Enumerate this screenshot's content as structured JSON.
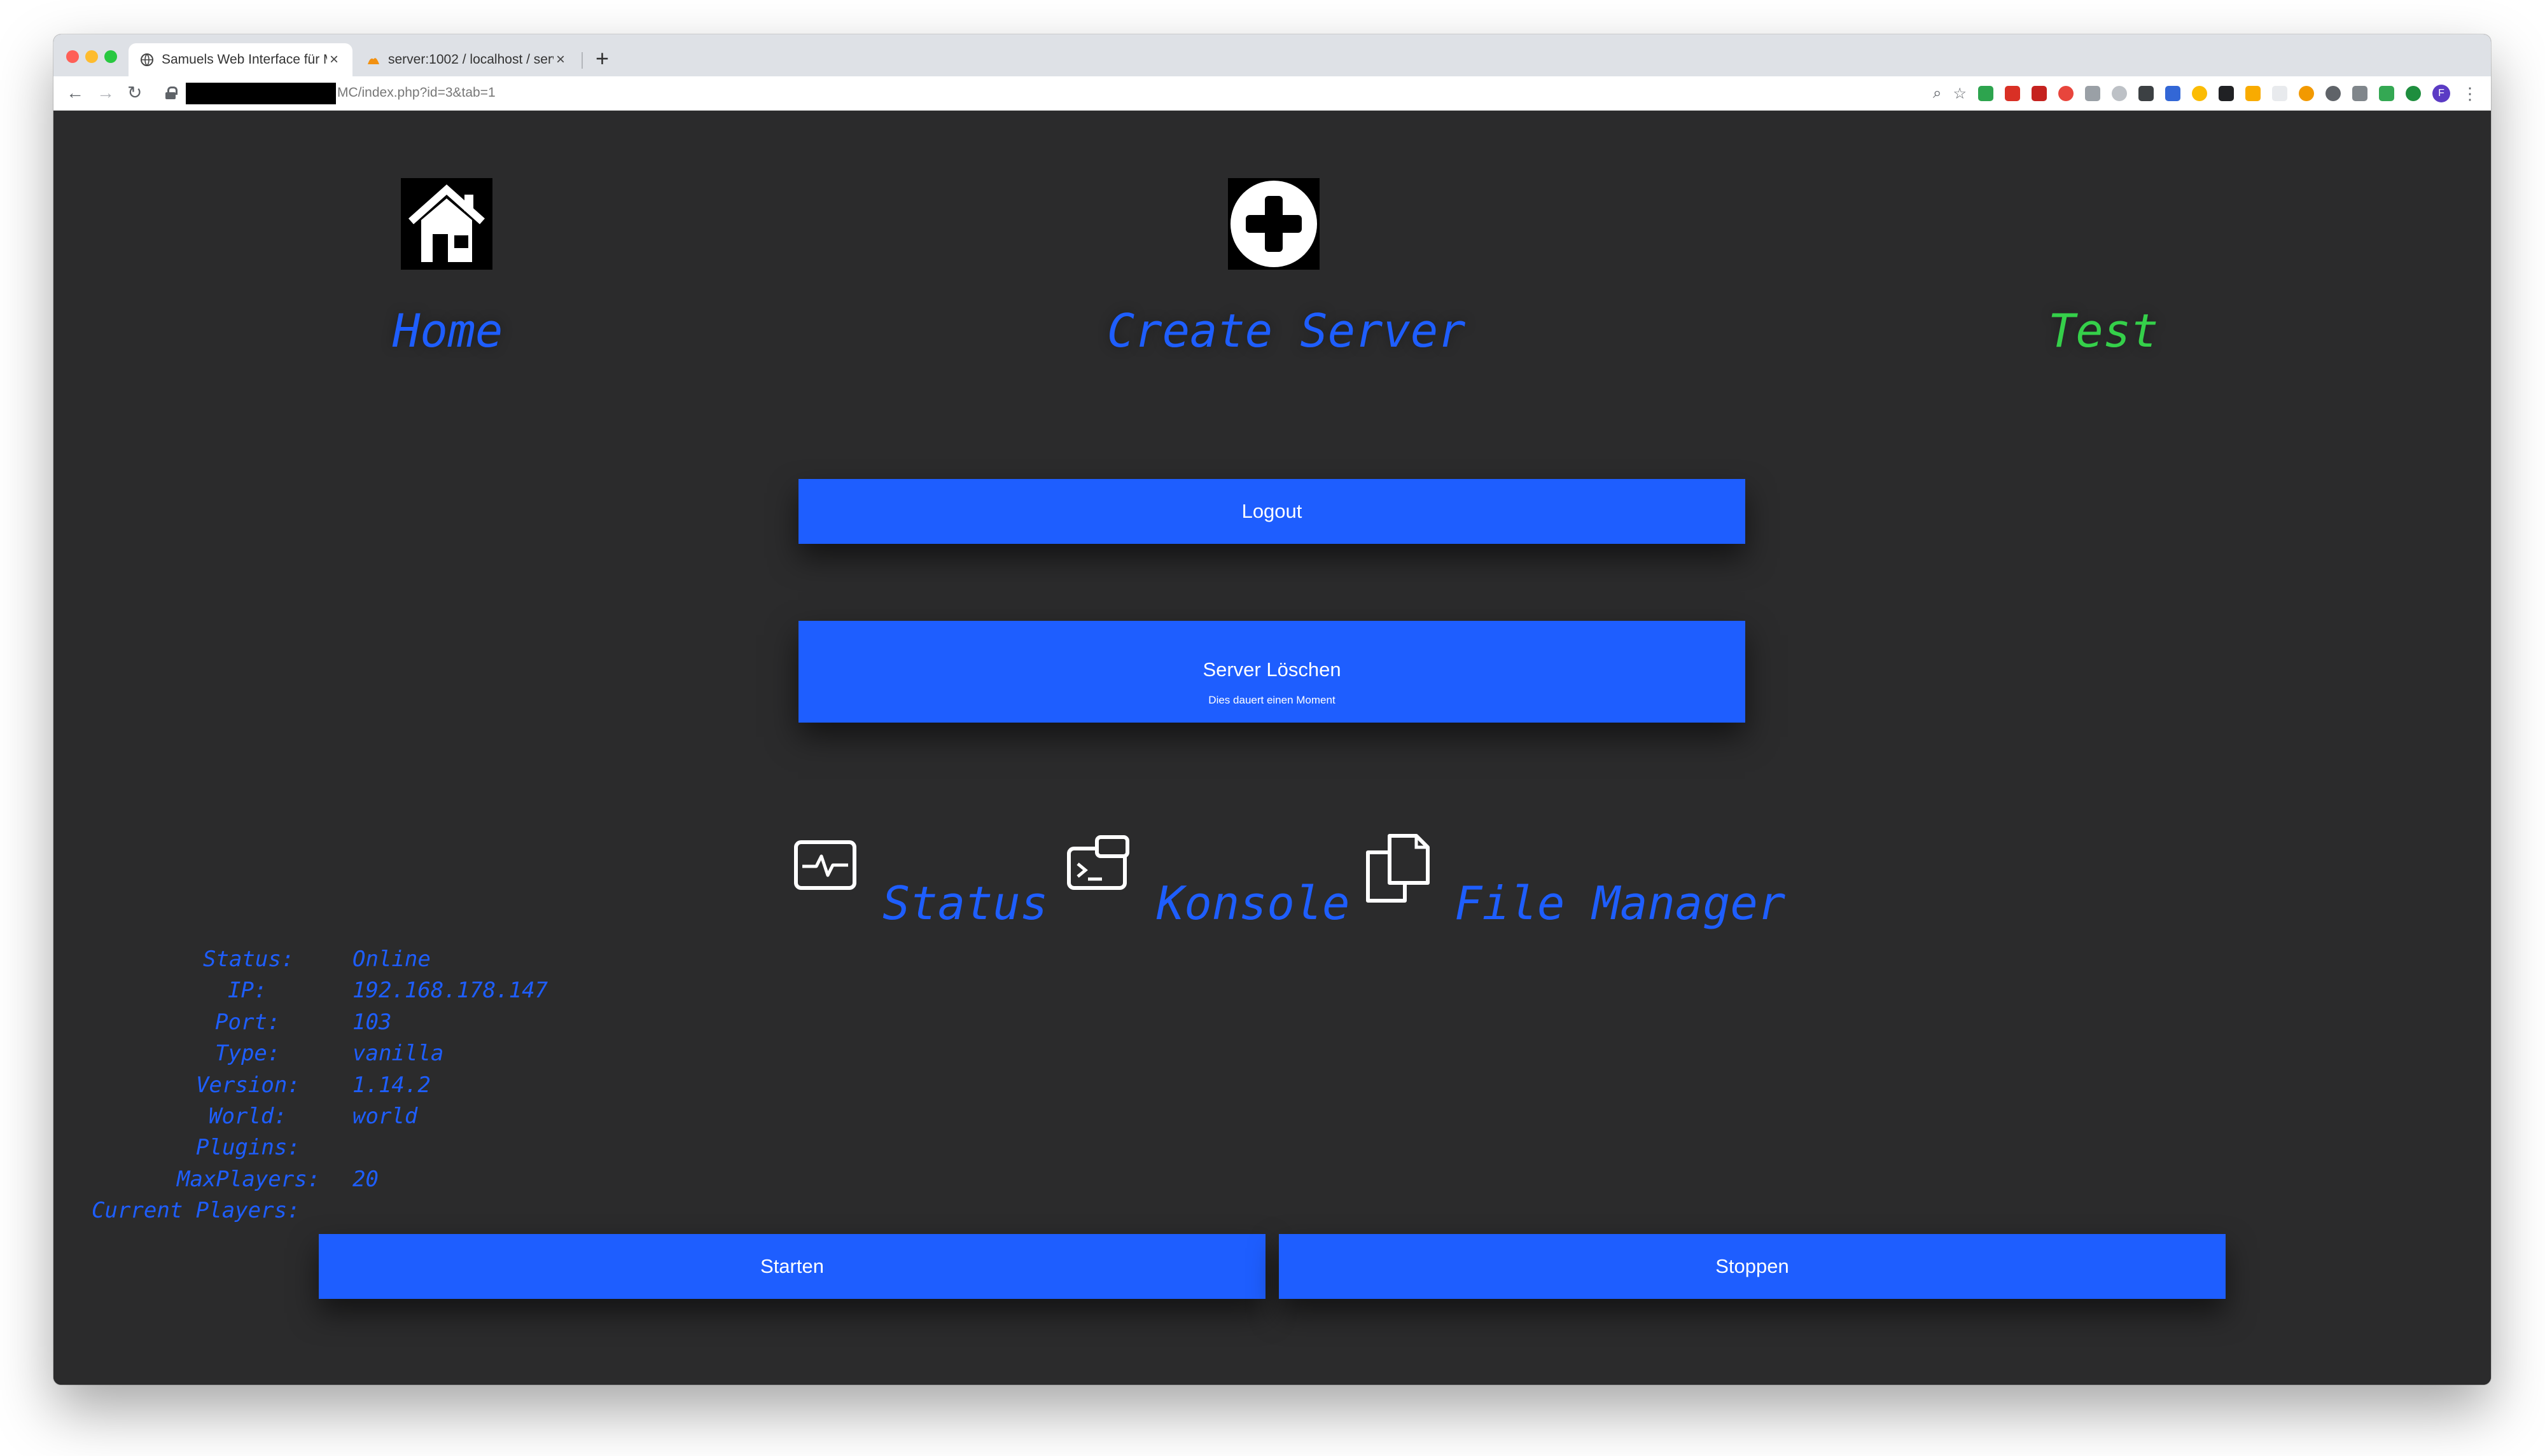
{
  "browser": {
    "tabs": [
      {
        "title": "Samuels Web Interface für Min",
        "favicon": "globe-icon",
        "active": true
      },
      {
        "title": "server:1002 / localhost / serve",
        "favicon": "phpmyadmin-icon",
        "active": false
      }
    ],
    "url": "MC/index.php?id=3&tab=1",
    "profile_initial": "F"
  },
  "nav": {
    "home": {
      "label": "Home",
      "icon": "home-icon"
    },
    "create": {
      "label": "Create Server",
      "icon": "plus-circle-icon"
    },
    "test": {
      "label": "Test"
    }
  },
  "buttons": {
    "logout": "Logout",
    "delete": "Server Löschen",
    "delete_sub": "Dies dauert einen Moment",
    "start": "Starten",
    "stop": "Stoppen"
  },
  "subnav": [
    {
      "label": "Status",
      "icon": "activity-monitor-icon"
    },
    {
      "label": "Konsole",
      "icon": "terminal-icon"
    },
    {
      "label": "File Manager",
      "icon": "copy-files-icon"
    }
  ],
  "server_info": [
    {
      "key": "Status:",
      "value": "Online"
    },
    {
      "key": "IP:",
      "value": "192.168.178.147"
    },
    {
      "key": "Port:",
      "value": "103"
    },
    {
      "key": "Type:",
      "value": "vanilla"
    },
    {
      "key": "Version:",
      "value": "1.14.2"
    },
    {
      "key": "World:",
      "value": "world"
    },
    {
      "key": "Plugins:",
      "value": ""
    },
    {
      "key": "MaxPlayers:",
      "value": "20"
    },
    {
      "key": "Current Players:",
      "value": ""
    }
  ],
  "colors": {
    "accent": "#1e5eff",
    "test_label": "#35d04a",
    "background": "#2b2b2c"
  }
}
